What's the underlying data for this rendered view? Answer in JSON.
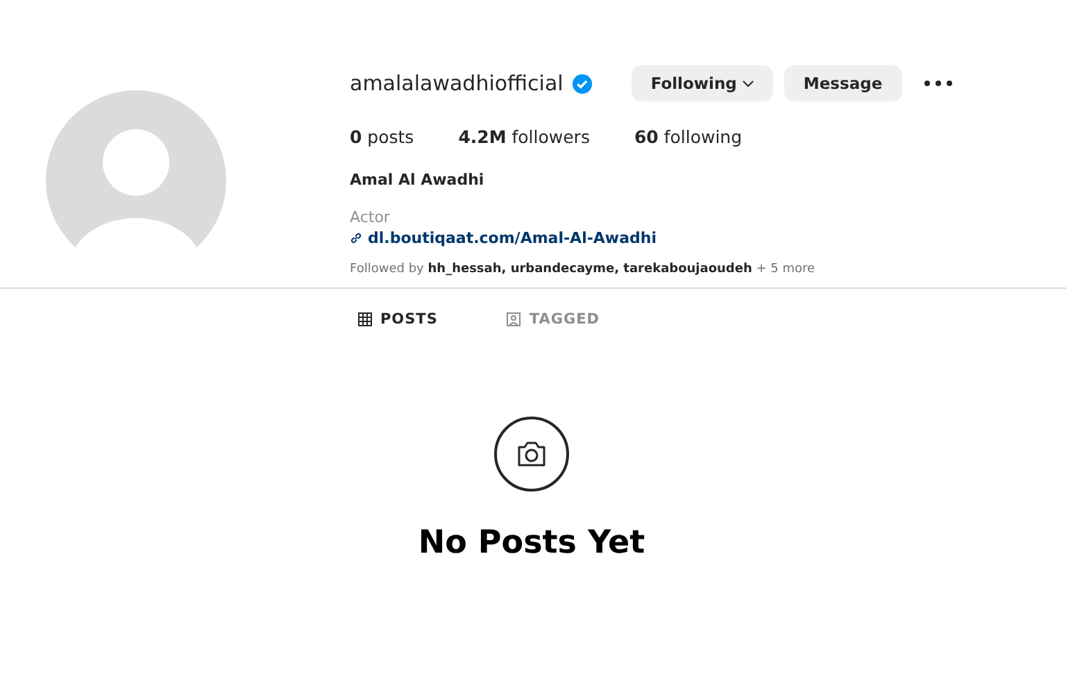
{
  "profile": {
    "username": "amalalawadhiofficial",
    "verified": true,
    "buttons": [
      {
        "label": "Following",
        "kind": "dropdown"
      },
      {
        "label": "Message",
        "kind": "plain"
      }
    ],
    "stats": [
      "**0** posts",
      "**4.2M** followers",
      "**60** following"
    ],
    "name": "Amal Al Awadhi",
    "category": "Actor",
    "link": "dl.boutiqaat.com/Amal-Al-Awadhi",
    "followed_by": "Followed by **hh_hessah, urbandecayme, tarekaboujaoudeh** + 5 more"
  },
  "tabs": [
    {
      "label": "POSTS",
      "kind": "grid",
      "selected": true
    },
    {
      "label": "TAGGED",
      "kind": "tag",
      "selected": false
    }
  ],
  "empty": {
    "title": "No Posts Yet"
  }
}
